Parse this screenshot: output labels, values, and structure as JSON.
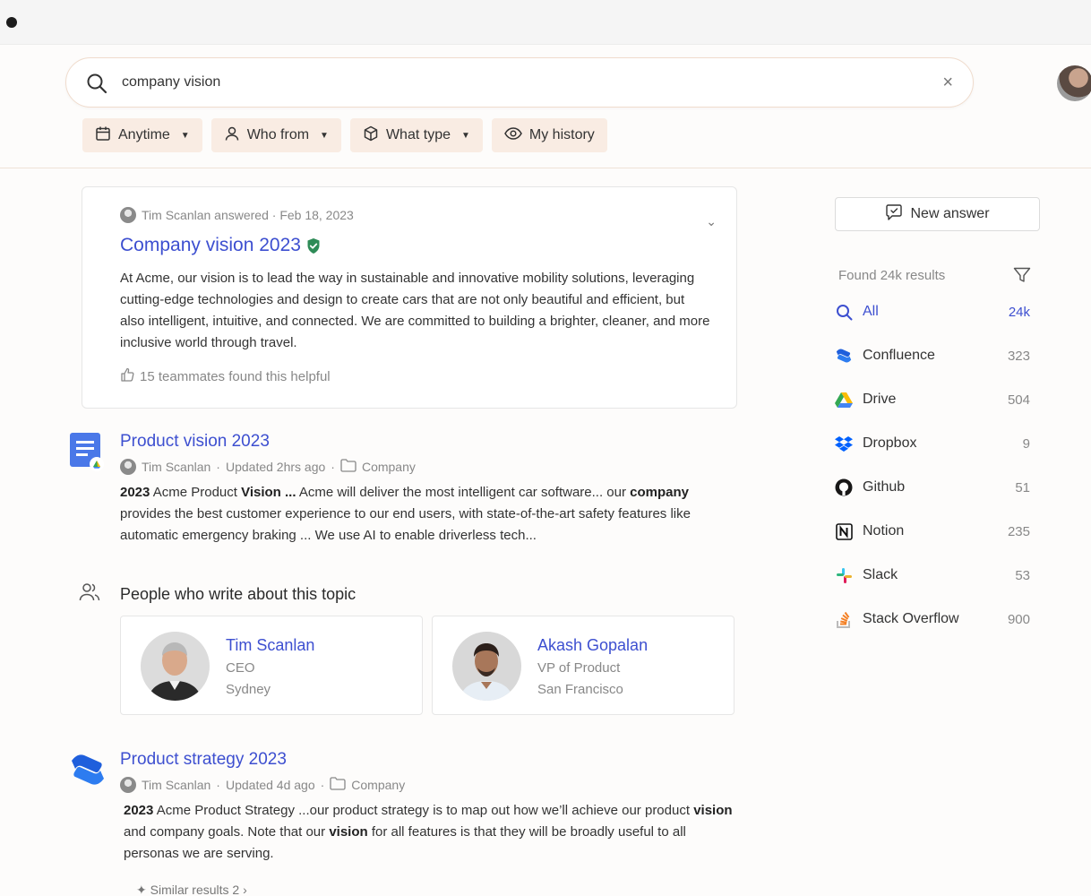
{
  "search": {
    "query": "company vision",
    "clear_label": "×"
  },
  "filters": [
    {
      "label": "Anytime",
      "icon": "calendar-icon"
    },
    {
      "label": "Who from",
      "icon": "person-icon"
    },
    {
      "label": "What type",
      "icon": "cube-icon"
    },
    {
      "label": "My history",
      "icon": "eye-icon"
    }
  ],
  "answer_card": {
    "author": "Tim Scanlan",
    "meta": "Tim Scanlan answered · Feb 18, 2023",
    "title": "Company vision 2023",
    "body": "At Acme, our vision is to lead the way in sustainable and innovative mobility solutions, leveraging cutting-edge technologies and design to create cars that are not only beautiful and efficient, but also intelligent, intuitive, and connected. We are committed to building a brighter, cleaner, and more inclusive world through travel.",
    "helpful": "15 teammates found this helpful"
  },
  "results": [
    {
      "title": "Product vision 2023",
      "author": "Tim Scanlan",
      "updated": "Updated 2hrs ago",
      "folder": "Company",
      "icon": "google-docs-icon"
    },
    {
      "title": "Product strategy 2023",
      "author": "Tim Scanlan",
      "updated": "Updated 4d ago",
      "folder": "Company",
      "icon": "confluence-icon"
    }
  ],
  "people": {
    "heading": "People who write about this topic",
    "list": [
      {
        "name": "Tim Scanlan",
        "role": "CEO",
        "location": "Sydney"
      },
      {
        "name": "Akash Gopalan",
        "role": "VP of Product",
        "location": "San Francisco"
      }
    ]
  },
  "similar": "Similar results 2",
  "sidebar": {
    "new_answer": "New answer",
    "found": "Found 24k results",
    "sources": [
      {
        "name": "All",
        "count": "24k",
        "icon": "search-icon",
        "color": "#3d4fd0"
      },
      {
        "name": "Confluence",
        "count": "323",
        "icon": "confluence-icon",
        "color": "#1868db"
      },
      {
        "name": "Drive",
        "count": "504",
        "icon": "drive-icon",
        "color": "#fbbc04"
      },
      {
        "name": "Dropbox",
        "count": "9",
        "icon": "dropbox-icon",
        "color": "#0061fe"
      },
      {
        "name": "Github",
        "count": "51",
        "icon": "github-icon",
        "color": "#181717"
      },
      {
        "name": "Notion",
        "count": "235",
        "icon": "notion-icon",
        "color": "#111111"
      },
      {
        "name": "Slack",
        "count": "53",
        "icon": "slack-icon",
        "color": "#e01e5a"
      },
      {
        "name": "Stack Overflow",
        "count": "900",
        "icon": "stackoverflow-icon",
        "color": "#f48024"
      }
    ]
  },
  "colors": {
    "link": "#3d4fd0",
    "chip_bg": "#f9ece3",
    "verified": "#2e8b57"
  }
}
